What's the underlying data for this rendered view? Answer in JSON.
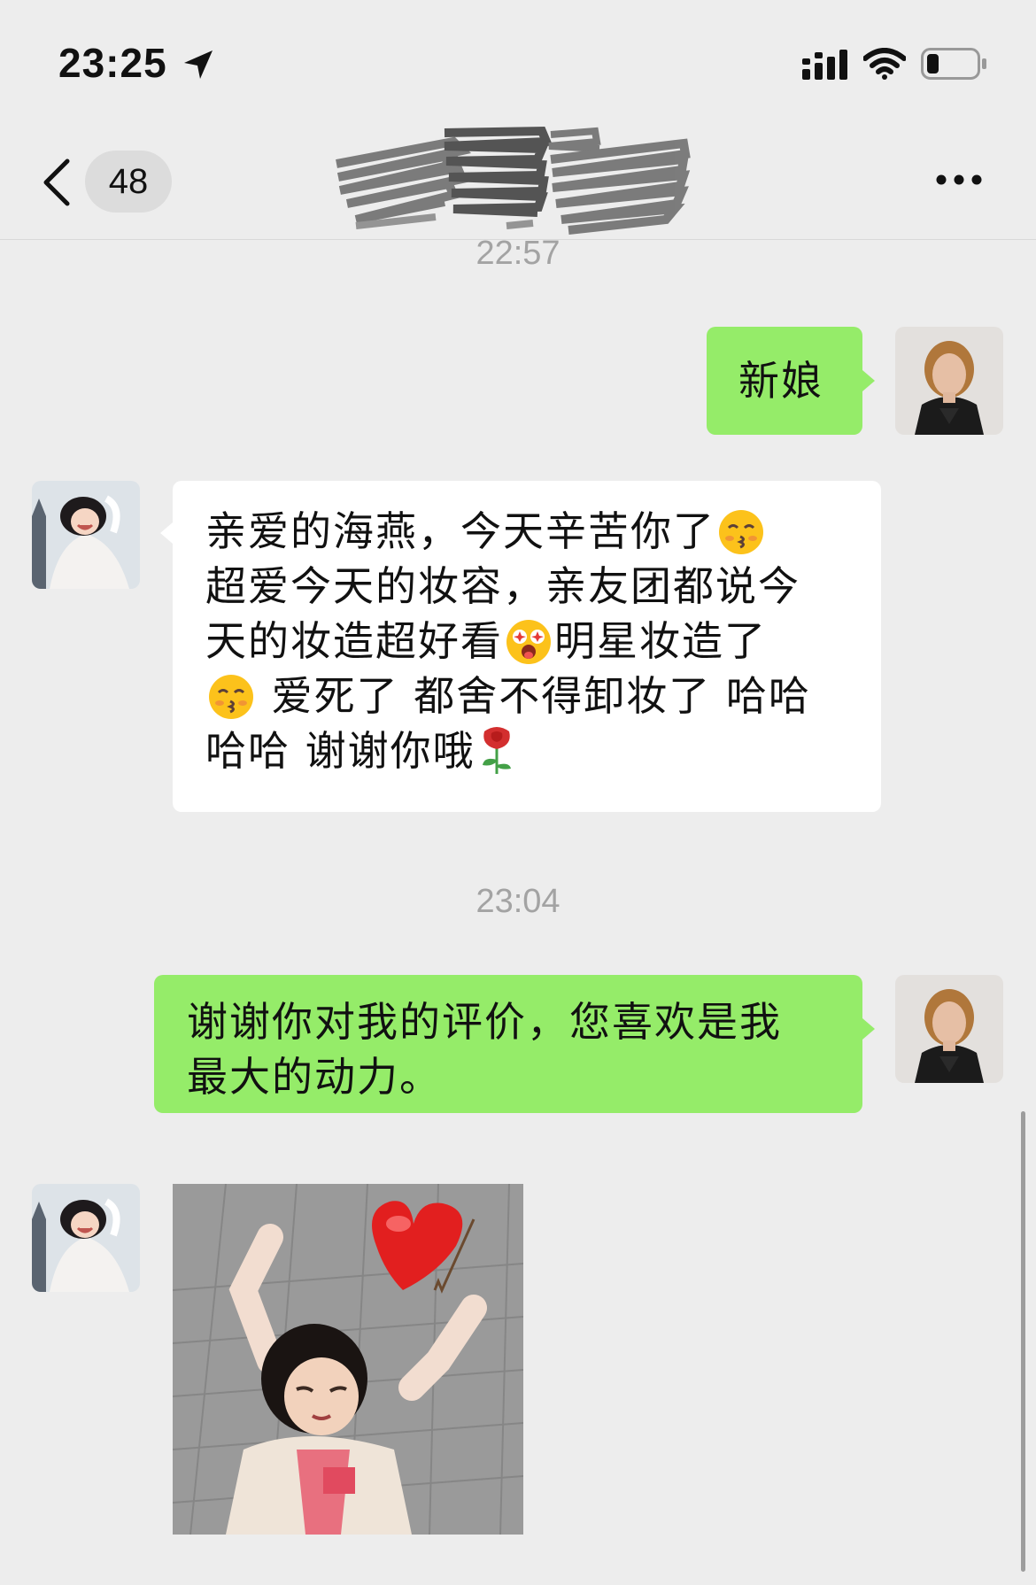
{
  "status_bar": {
    "time": "23:25",
    "icons": [
      "location-arrow-icon",
      "cellular-signal-icon",
      "wifi-icon",
      "battery-icon"
    ],
    "battery_level_percent": 20
  },
  "nav": {
    "unread_count": "48",
    "title_redacted": true,
    "icons": [
      "back-chevron-icon",
      "more-icon"
    ]
  },
  "messages": [
    {
      "type": "timestamp",
      "text": "22:57"
    },
    {
      "type": "text",
      "direction": "sent",
      "text": "新娘"
    },
    {
      "type": "text",
      "direction": "received",
      "lines": [
        {
          "text": "亲爱的海燕，今天辛苦你了",
          "emoji_after": "kissing-face-emoji"
        },
        {
          "text": "超爱今天的妆容，亲友团都说今"
        },
        {
          "text": "天的妆造超好看",
          "emoji_after": "star-struck-emoji",
          "text_after": "明星妆造了"
        },
        {
          "emoji_before": "kissing-face-emoji",
          "text": " 爱死了 都舍不得卸妆了 哈哈"
        },
        {
          "text": "哈哈 谢谢你哦",
          "emoji_after": "rose-emoji"
        }
      ]
    },
    {
      "type": "timestamp",
      "text": "23:04"
    },
    {
      "type": "text",
      "direction": "sent",
      "lines": [
        "谢谢你对我的评价，您喜欢是我",
        "最大的动力。"
      ]
    },
    {
      "type": "sticker",
      "direction": "received",
      "description_icon": "heart-sticker-icon"
    }
  ],
  "colors": {
    "background": "#ededed",
    "sent_bubble": "#95ec69",
    "received_bubble": "#ffffff",
    "timestamp_text": "#a3a3a3"
  }
}
